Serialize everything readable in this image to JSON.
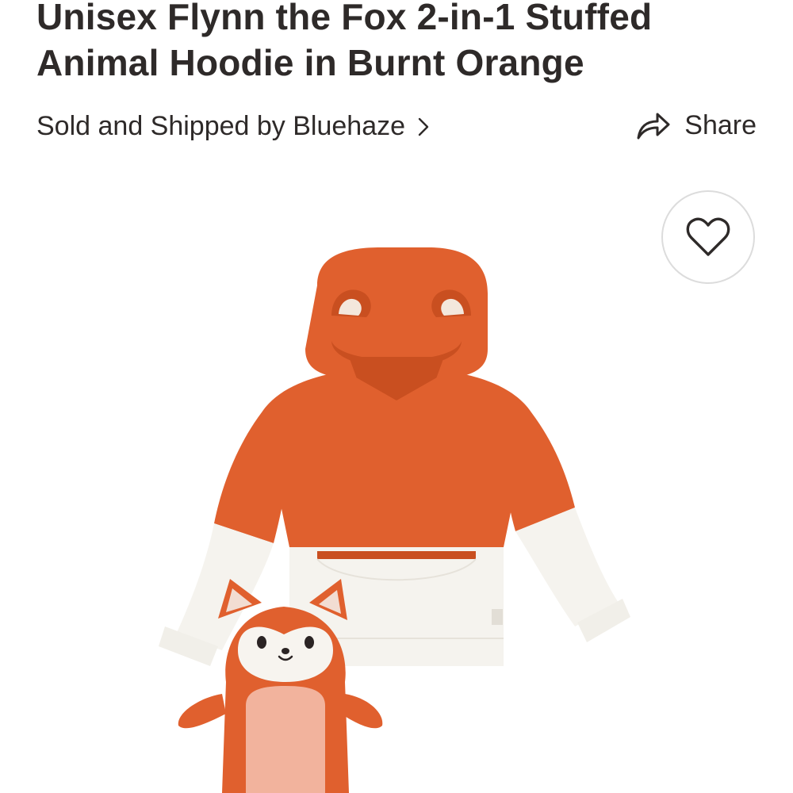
{
  "product": {
    "title": "Unisex Flynn the Fox 2-in-1 Stuffed Animal Hoodie in Burnt Orange",
    "seller_text": "Sold and Shipped by Bluehaze",
    "share_label": "Share",
    "image_alt_subject": "fox hoodie with stuffed fox",
    "colors": {
      "orange": "#e0602e",
      "orange_dark": "#c94f20",
      "cream": "#f5f3ee"
    }
  },
  "icons": {
    "chevron": "chevron-right-icon",
    "share": "share-arrow-icon",
    "favorite": "heart-outline-icon"
  }
}
